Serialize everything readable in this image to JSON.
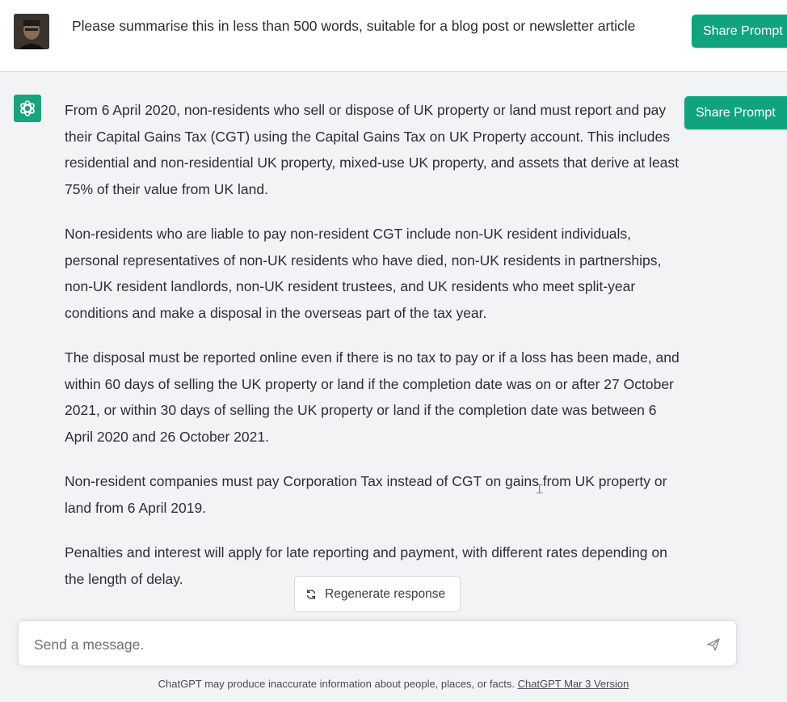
{
  "user_message": {
    "text": "Please summarise this in less than 500 words, suitable for a blog post or newsletter article",
    "share_label": "Share Prompt"
  },
  "assistant_message": {
    "share_label": "Share Prompt",
    "paragraphs": [
      "From 6 April 2020, non-residents who sell or dispose of UK property or land must report and pay their Capital Gains Tax (CGT) using the Capital Gains Tax on UK Property account. This includes residential and non-residential UK property, mixed-use UK property, and assets that derive at least 75% of their value from UK land.",
      "Non-residents who are liable to pay non-resident CGT include non-UK resident individuals, personal representatives of non-UK residents who have died, non-UK residents in partnerships, non-UK resident landlords, non-UK resident trustees, and UK residents who meet split-year conditions and make a disposal in the overseas part of the tax year.",
      "The disposal must be reported online even if there is no tax to pay or if a loss has been made, and within 60 days of selling the UK property or land if the completion date was on or after 27 October 2021, or within 30 days of selling the UK property or land if the completion date was between 6 April 2020 and 26 October 2021.",
      "Non-resident companies must pay Corporation Tax instead of CGT on gains from UK property or land from 6 April 2019.",
      "Penalties and interest will apply for late reporting and payment, with different rates depending on the length of delay."
    ]
  },
  "regenerate": {
    "label": "Regenerate response"
  },
  "composer": {
    "placeholder": "Send a message."
  },
  "footer": {
    "text": "ChatGPT may produce inaccurate information about people, places, or facts. ",
    "link": "ChatGPT Mar 3 Version"
  },
  "colors": {
    "accent": "#10a37f",
    "assistant_bg": "#f2f3f5"
  },
  "icons": {
    "avatar": "user-avatar",
    "assistant": "openai-logo-icon",
    "regenerate": "refresh-icon",
    "send": "send-icon"
  }
}
